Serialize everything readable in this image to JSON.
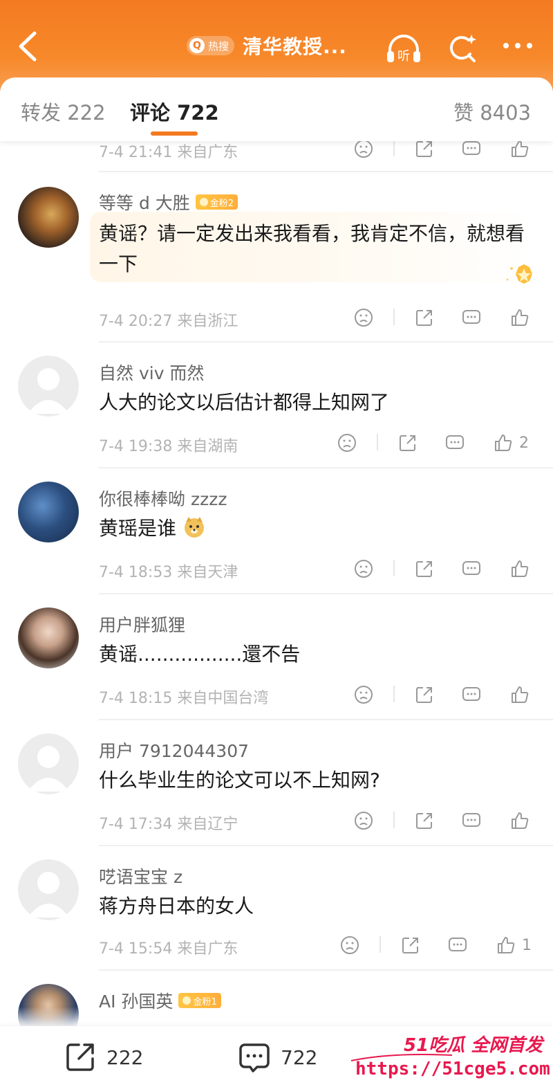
{
  "header": {
    "hot_badge": "热搜",
    "title": "清华教授...",
    "back_icon": "chevron-left-icon",
    "listen_icon": "headphones-icon",
    "listen_label": "听",
    "search_icon": "search-icon",
    "more_icon": "more-icon",
    "bg_color": "#f47a21"
  },
  "tabs": {
    "repost": "转发 222",
    "comments": "评论 722",
    "likes": "赞 8403",
    "accent": "#f47a21"
  },
  "comments": [
    {
      "meta": "7-4 21:41 来自广东",
      "likes": ""
    },
    {
      "username": "等等 d 大胜",
      "badge": "金粉2",
      "content": "黄谣？请一定发出来我看看，我肯定不信，就想看一下",
      "meta": "7-4 20:27 来自浙江",
      "likes": ""
    },
    {
      "username": "自然 viv 而然",
      "content": "人大的论文以后估计都得上知网了",
      "meta": "7-4 19:38 来自湖南",
      "likes": "2"
    },
    {
      "username": "你很棒棒呦 zzzz",
      "content": "黄瑶是谁",
      "meta": "7-4 18:53 来自天津",
      "likes": ""
    },
    {
      "username": "用户胖狐狸",
      "content": "黄谣.................還不告",
      "meta": "7-4 18:15 来自中国台湾",
      "likes": ""
    },
    {
      "username": "用户 7912044307",
      "content": "什么毕业生的论文可以不上知网?",
      "meta": "7-4 17:34 来自辽宁",
      "likes": ""
    },
    {
      "username": "呓语宝宝 z",
      "content": "蒋方舟日本的女人",
      "meta": "7-4 15:54 来自广东",
      "likes": "1"
    },
    {
      "username": "AI 孙国英",
      "badge": "金粉1"
    }
  ],
  "bottom_bar": {
    "repost_count": "222",
    "comment_count": "722"
  },
  "watermark": {
    "title": "51吃瓜 全网首发",
    "url": "https://51cge5.com"
  }
}
